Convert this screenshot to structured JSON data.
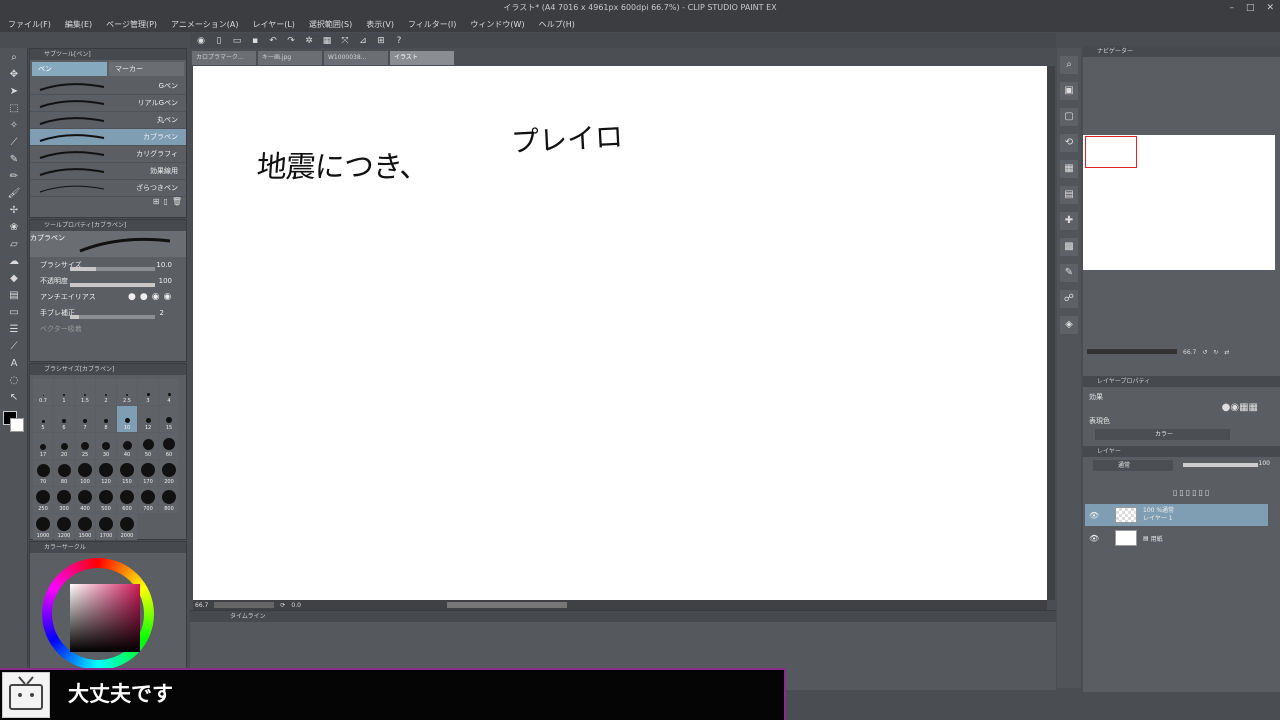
{
  "window": {
    "title": "イラスト* (A4 7016 x 4961px 600dpi 66.7%) - CLIP STUDIO PAINT EX"
  },
  "menu": [
    "ファイル(F)",
    "編集(E)",
    "ページ管理(P)",
    "アニメーション(A)",
    "レイヤー(L)",
    "選択範囲(S)",
    "表示(V)",
    "フィルター(I)",
    "ウィンドウ(W)",
    "ヘルプ(H)"
  ],
  "subtool": {
    "header": "サブツール[ペン]",
    "tabs": [
      "ペン",
      "マーカー"
    ],
    "brushes": [
      "Gペン",
      "リアルGペン",
      "丸ペン",
      "カブラペン",
      "カリグラフィ",
      "効果線用",
      "ざらつきペン"
    ],
    "selected_index": 3
  },
  "toolprop": {
    "header": "ツールプロパティ[カブラペン]",
    "name": "カブラペン",
    "brush_size_label": "ブラシサイズ",
    "brush_size": "10.0",
    "opacity_label": "不透明度",
    "opacity": "100",
    "antialias_label": "アンチエイリアス",
    "stabilize_label": "手ブレ補正",
    "stabilize": "2",
    "vector_label": "ベクター吸着"
  },
  "brushsize": {
    "header": "ブラシサイズ[カブラペン]",
    "sizes": [
      "0.7",
      "1",
      "1.5",
      "2",
      "2.5",
      "3",
      "4",
      "5",
      "6",
      "7",
      "8",
      "10",
      "12",
      "15",
      "17",
      "20",
      "25",
      "30",
      "40",
      "50",
      "60",
      "70",
      "80",
      "100",
      "120",
      "150",
      "170",
      "200",
      "250",
      "300",
      "400",
      "500",
      "600",
      "700",
      "800",
      "1000",
      "1200",
      "1500",
      "1700",
      "2000"
    ],
    "selected": "10"
  },
  "color": {
    "header": "カラーサークル"
  },
  "doc_tabs": [
    "カロプラマーク...",
    "キー画.jpg",
    "W1000038...",
    "イラスト"
  ],
  "canvas_text": {
    "left": "地震につき、",
    "right": "プレイロ"
  },
  "status": {
    "zoom": "66.7",
    "angle": "0.0"
  },
  "bottom_panel": {
    "header": "タイムライン"
  },
  "navigator": {
    "header": "ナビゲーター",
    "zoom": "66.7"
  },
  "layer_prop": {
    "header": "レイヤープロパティ",
    "effect_label": "効果",
    "express_label": "表現色",
    "express_value": "カラー"
  },
  "layers": {
    "header": "レイヤー",
    "blend": "通常",
    "opacity": "100",
    "items": [
      {
        "pct": "100 %通常",
        "name": "レイヤー 1"
      },
      {
        "pct": "",
        "name": "用紙"
      }
    ]
  },
  "overlay": {
    "message": "大丈夫です"
  }
}
